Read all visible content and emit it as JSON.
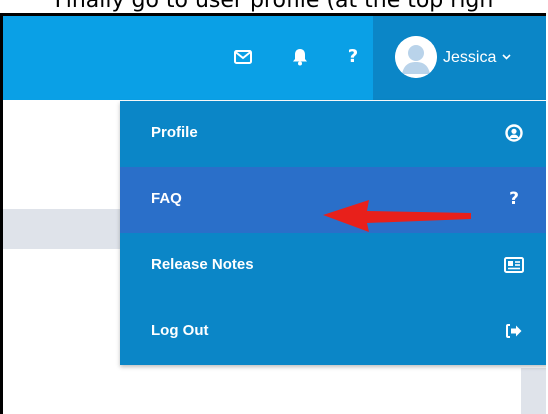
{
  "caption": "Finally go to user profile (at the top righ",
  "topbar": {
    "icons": [
      "mail-icon",
      "bell-icon",
      "help-icon"
    ],
    "help_glyph": "?",
    "username": "Jessica",
    "chevron": "⌄"
  },
  "menu": {
    "items": [
      {
        "label": "Profile",
        "icon": "user-circle-icon"
      },
      {
        "label": "FAQ",
        "icon": "question-icon",
        "glyph": "?"
      },
      {
        "label": "Release Notes",
        "icon": "newspaper-icon"
      },
      {
        "label": "Log Out",
        "icon": "sign-out-icon"
      }
    ],
    "active_item": "FAQ"
  },
  "colors": {
    "topbar": "#0aa0e6",
    "user_section": "#0b86c7",
    "dropdown": "#0b86c7",
    "active_item": "#2a6fc9",
    "arrow": "#e8201b"
  }
}
